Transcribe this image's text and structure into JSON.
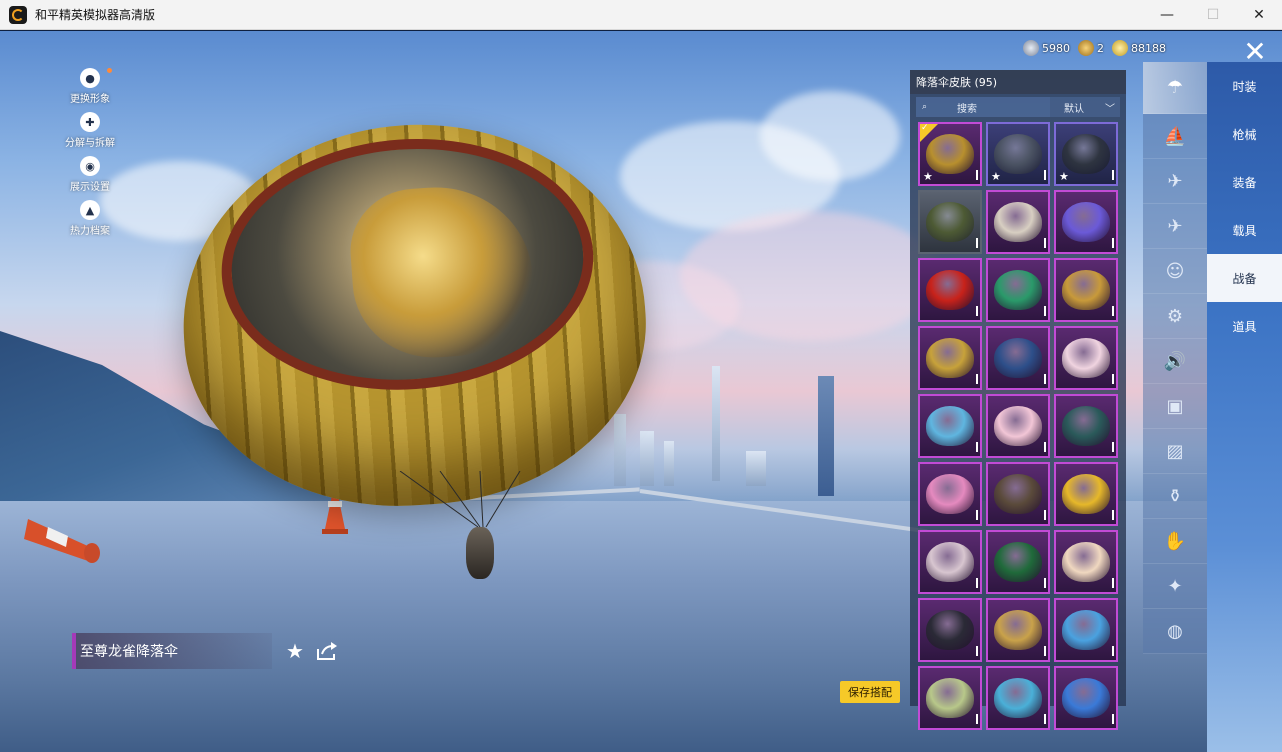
{
  "window": {
    "title": "和平精英模拟器高清版",
    "buttons": [
      "—",
      "☐",
      "✕"
    ]
  },
  "left_menu": [
    {
      "label": "更换形象",
      "icon": "avatar-icon",
      "has_dot": true
    },
    {
      "label": "分解与拆解",
      "icon": "puzzle-icon",
      "has_dot": false
    },
    {
      "label": "展示设置",
      "icon": "eye-icon",
      "has_dot": false
    },
    {
      "label": "热力档案",
      "icon": "flame-icon",
      "has_dot": false
    }
  ],
  "currency": [
    {
      "value": "5980",
      "icon": "silver-coin-icon",
      "color": "#9aa6b8"
    },
    {
      "value": "2",
      "icon": "gold-badge-icon",
      "color": "#d6a53a"
    },
    {
      "value": "88188",
      "icon": "gold-coin-icon",
      "color": "#e2c044"
    }
  ],
  "item": {
    "name": "至尊龙雀降落伞"
  },
  "save_button": "保存搭配",
  "panel": {
    "title": "降落伞皮肤 (95)",
    "search_placeholder": "搜索",
    "sort_label": "默认",
    "items": [
      {
        "rarity": "purple",
        "color": "#b8902e",
        "star": true,
        "selected": true
      },
      {
        "rarity": "blue",
        "color": "#4a5262",
        "star": true
      },
      {
        "rarity": "blue",
        "color": "#2e3440",
        "star": true
      },
      {
        "rarity": "grey",
        "color": "#4d5a34"
      },
      {
        "rarity": "purple",
        "color": "#d8cfc2"
      },
      {
        "rarity": "purple",
        "color": "#6b5ad8"
      },
      {
        "rarity": "purple",
        "color": "#c8221a"
      },
      {
        "rarity": "purple",
        "color": "#2a9a6a"
      },
      {
        "rarity": "purple",
        "color": "#c89a3a"
      },
      {
        "rarity": "purple",
        "color": "#c7a23a"
      },
      {
        "rarity": "purple",
        "color": "#2d4f8a"
      },
      {
        "rarity": "purple",
        "color": "#f0d4e0"
      },
      {
        "rarity": "purple",
        "color": "#5fb6e0"
      },
      {
        "rarity": "purple",
        "color": "#f2c6d6"
      },
      {
        "rarity": "purple",
        "color": "#2a5a5a"
      },
      {
        "rarity": "purple",
        "color": "#e58abf"
      },
      {
        "rarity": "purple",
        "color": "#5a4a3a"
      },
      {
        "rarity": "purple",
        "color": "#e6b82a"
      },
      {
        "rarity": "purple",
        "color": "#d8c6d0"
      },
      {
        "rarity": "purple",
        "color": "#1f6a3a"
      },
      {
        "rarity": "purple",
        "color": "#f0d8c0"
      },
      {
        "rarity": "purple",
        "color": "#2a2a36"
      },
      {
        "rarity": "purple",
        "color": "#c9a24a"
      },
      {
        "rarity": "purple",
        "color": "#4aa2e0"
      },
      {
        "rarity": "purple",
        "color": "#b8c88a"
      },
      {
        "rarity": "purple",
        "color": "#4ab0d8"
      },
      {
        "rarity": "purple",
        "color": "#3a7ad8"
      }
    ]
  },
  "category_icons": [
    {
      "icon": "parachute-icon",
      "active": true
    },
    {
      "icon": "boat-icon"
    },
    {
      "icon": "drone-icon"
    },
    {
      "icon": "plane-icon"
    },
    {
      "icon": "emote-icon"
    },
    {
      "icon": "robot-icon"
    },
    {
      "icon": "speaker-icon"
    },
    {
      "icon": "pet-icon"
    },
    {
      "icon": "photo-icon"
    },
    {
      "icon": "extinguisher-icon"
    },
    {
      "icon": "hand-icon"
    },
    {
      "icon": "sparkle-icon"
    },
    {
      "icon": "ufo-icon"
    }
  ],
  "tabs": [
    {
      "label": "时装"
    },
    {
      "label": "枪械"
    },
    {
      "label": "装备"
    },
    {
      "label": "载具"
    },
    {
      "label": "战备",
      "active": true
    },
    {
      "label": "道具"
    }
  ]
}
